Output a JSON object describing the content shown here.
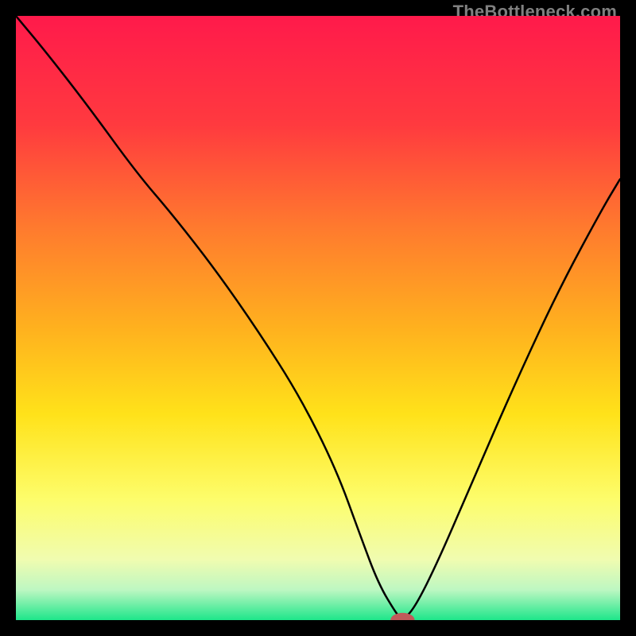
{
  "watermark": "TheBottleneck.com",
  "chart_data": {
    "type": "line",
    "title": "",
    "xlabel": "",
    "ylabel": "",
    "xlim": [
      0,
      100
    ],
    "ylim": [
      0,
      100
    ],
    "grid": false,
    "legend": false,
    "gradient_stops": [
      {
        "offset": 0,
        "color": "#ff1a4b"
      },
      {
        "offset": 18,
        "color": "#ff3a3f"
      },
      {
        "offset": 35,
        "color": "#ff7a2e"
      },
      {
        "offset": 52,
        "color": "#ffb21e"
      },
      {
        "offset": 66,
        "color": "#ffe21a"
      },
      {
        "offset": 80,
        "color": "#fdfd6b"
      },
      {
        "offset": 90,
        "color": "#f0fcb0"
      },
      {
        "offset": 95,
        "color": "#bdf7c2"
      },
      {
        "offset": 100,
        "color": "#1ee68a"
      }
    ],
    "curve": {
      "x": [
        0,
        5,
        12,
        20,
        26,
        33,
        40,
        47,
        53,
        57,
        60,
        63,
        64,
        66,
        70,
        76,
        83,
        90,
        97,
        100
      ],
      "y": [
        100,
        94,
        85,
        74,
        67,
        58,
        48,
        37,
        25,
        14,
        6,
        1,
        0,
        2,
        10,
        24,
        40,
        55,
        68,
        73
      ]
    },
    "marker": {
      "x": 64,
      "y": 0,
      "rx": 2.0,
      "ry": 1.2,
      "color": "#c05a5a"
    }
  }
}
